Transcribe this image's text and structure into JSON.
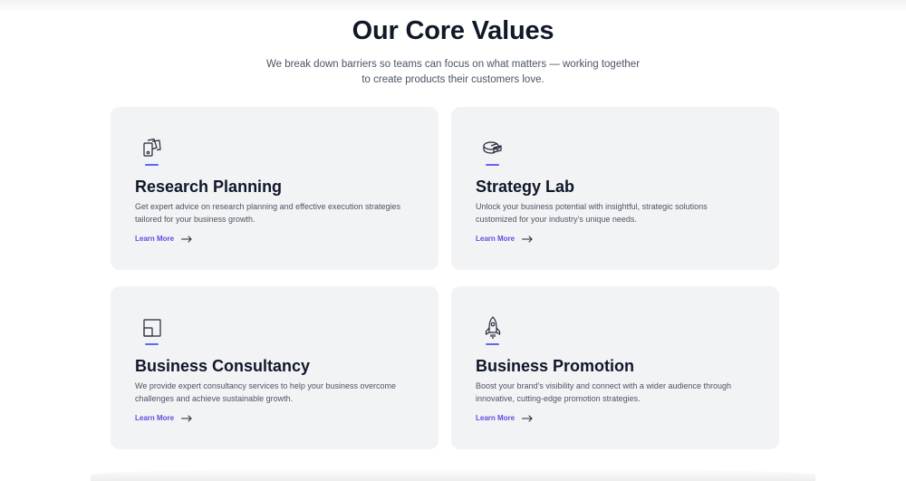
{
  "header": {
    "title": "Our Core Values",
    "subtitle_line1": "We break down barriers so teams can focus on what matters — working together",
    "subtitle_line2": "to create products their customers love."
  },
  "colors": {
    "card_background": "#f2f3f5",
    "accent": "#5b4fe0",
    "heading": "#111827",
    "body_text": "#4b5563"
  },
  "cards": [
    {
      "icon": "documents-icon",
      "title": "Research Planning",
      "desc_line1": "Get expert advice on research planning and effective execution strategies",
      "desc_line2": "tailored for your business growth.",
      "link_label": "Learn More"
    },
    {
      "icon": "pie-chart-icon",
      "title": "Strategy Lab",
      "desc_line1": "Unlock your business potential with insightful, strategic solutions",
      "desc_line2": "customized for your industry’s unique needs.",
      "link_label": "Learn More"
    },
    {
      "icon": "layers-square-icon",
      "title": "Business Consultancy",
      "desc_line1": "We provide expert consultancy services to help your business overcome",
      "desc_line2": "challenges and achieve sustainable growth.",
      "link_label": "Learn More"
    },
    {
      "icon": "rocket-icon",
      "title": "Business Promotion",
      "desc_line1": "Boost your brand’s visibility and connect with a wider audience through",
      "desc_line2": "innovative, cutting-edge promotion strategies.",
      "link_label": "Learn More"
    }
  ]
}
